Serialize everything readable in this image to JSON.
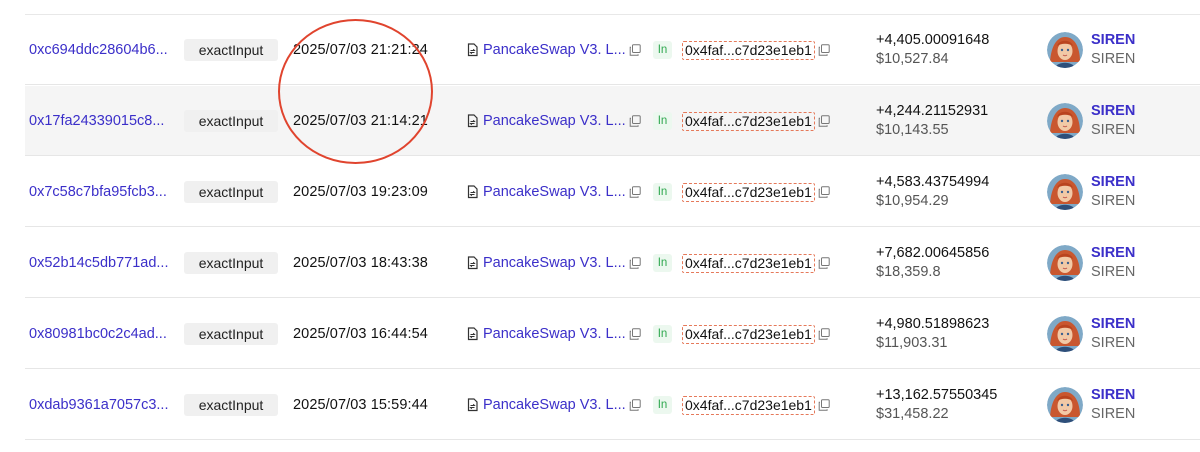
{
  "rows": [
    {
      "tx_hash": "0xc694ddc28604b6...",
      "method": "exactInput",
      "time": "2025/07/03 21:21:24",
      "dex": "PancakeSwap V3. L...",
      "direction": "In",
      "address": "0x4faf...c7d23e1eb1",
      "amount": "+4,405.00091648",
      "value_usd": "$10,527.84",
      "token_symbol": "SIREN",
      "token_name": "SIREN"
    },
    {
      "tx_hash": "0x17fa24339015c8...",
      "method": "exactInput",
      "time": "2025/07/03 21:14:21",
      "dex": "PancakeSwap V3. L...",
      "direction": "In",
      "address": "0x4faf...c7d23e1eb1",
      "amount": "+4,244.21152931",
      "value_usd": "$10,143.55",
      "token_symbol": "SIREN",
      "token_name": "SIREN"
    },
    {
      "tx_hash": "0x7c58c7bfa95fcb3...",
      "method": "exactInput",
      "time": "2025/07/03 19:23:09",
      "dex": "PancakeSwap V3. L...",
      "direction": "In",
      "address": "0x4faf...c7d23e1eb1",
      "amount": "+4,583.43754994",
      "value_usd": "$10,954.29",
      "token_symbol": "SIREN",
      "token_name": "SIREN"
    },
    {
      "tx_hash": "0x52b14c5db771ad...",
      "method": "exactInput",
      "time": "2025/07/03 18:43:38",
      "dex": "PancakeSwap V3. L...",
      "direction": "In",
      "address": "0x4faf...c7d23e1eb1",
      "amount": "+7,682.00645856",
      "value_usd": "$18,359.8",
      "token_symbol": "SIREN",
      "token_name": "SIREN"
    },
    {
      "tx_hash": "0x80981bc0c2c4ad...",
      "method": "exactInput",
      "time": "2025/07/03 16:44:54",
      "dex": "PancakeSwap V3. L...",
      "direction": "In",
      "address": "0x4faf...c7d23e1eb1",
      "amount": "+4,980.51898623",
      "value_usd": "$11,903.31",
      "token_symbol": "SIREN",
      "token_name": "SIREN"
    },
    {
      "tx_hash": "0xdab9361a7057c3...",
      "method": "exactInput",
      "time": "2025/07/03 15:59:44",
      "dex": "PancakeSwap V3. L...",
      "direction": "In",
      "address": "0x4faf...c7d23e1eb1",
      "amount": "+13,162.57550345",
      "value_usd": "$31,458.22",
      "token_symbol": "SIREN",
      "token_name": "SIREN"
    }
  ],
  "colors": {
    "link": "#3b2fc9",
    "annotation": "#e0442e",
    "in_badge": "#2fa84f",
    "address_border": "#e5795a",
    "row_highlight": "#f5f5f5"
  },
  "icons": {
    "dex": "document-swap-icon",
    "copy": "copy-icon",
    "token": "siren-token-avatar"
  }
}
